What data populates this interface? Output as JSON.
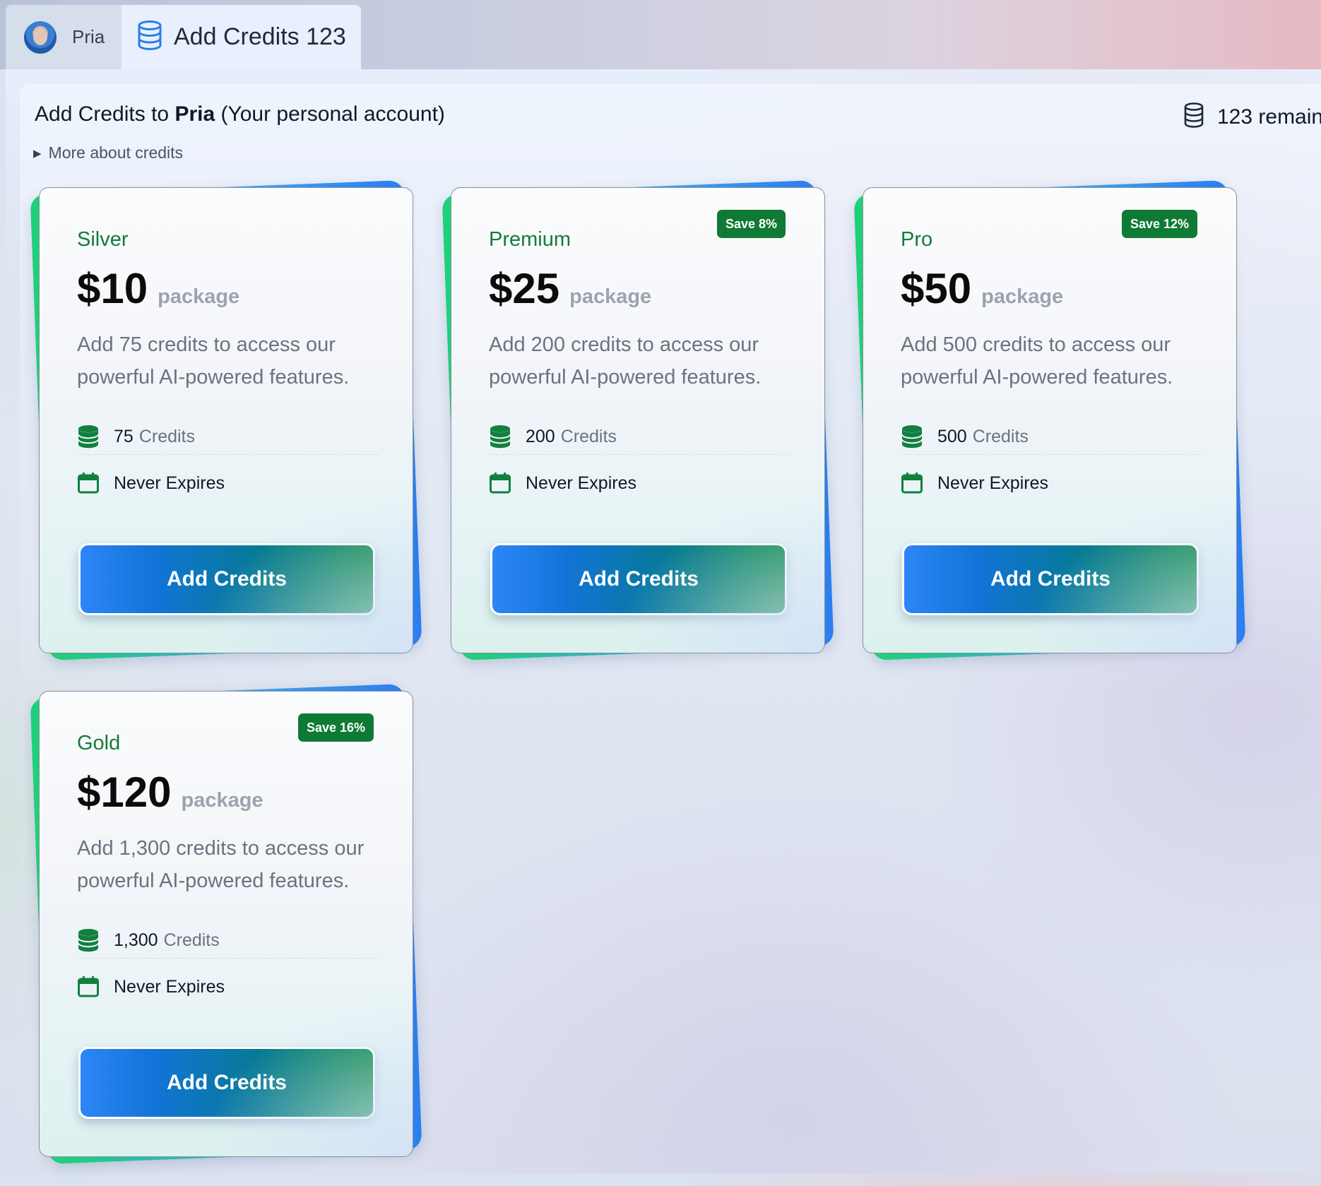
{
  "tabs": {
    "pria": {
      "label": "Pria"
    },
    "add_credits": {
      "label": "Add Credits 123"
    }
  },
  "header": {
    "prefix": "Add Credits to ",
    "account_name": "Pria",
    "suffix": " (Your personal account)",
    "remaining": "123 remain",
    "more_about": "More about credits"
  },
  "packages": [
    {
      "tier": "Silver",
      "badge": "",
      "price": "$10",
      "price_unit": "package",
      "description": "Add 75 credits to access our powerful AI-powered features.",
      "credits_value": "75",
      "credits_unit": "Credits",
      "expires": "Never Expires",
      "button": "Add Credits"
    },
    {
      "tier": "Premium",
      "badge": "Save 8%",
      "price": "$25",
      "price_unit": "package",
      "description": "Add 200 credits to access our powerful AI-powered features.",
      "credits_value": "200",
      "credits_unit": "Credits",
      "expires": "Never Expires",
      "button": "Add Credits"
    },
    {
      "tier": "Pro",
      "badge": "Save 12%",
      "price": "$50",
      "price_unit": "package",
      "description": "Add 500 credits to access our powerful AI-powered features.",
      "credits_value": "500",
      "credits_unit": "Credits",
      "expires": "Never Expires",
      "button": "Add Credits"
    },
    {
      "tier": "Gold",
      "badge": "Save 16%",
      "price": "$120",
      "price_unit": "package",
      "description": "Add 1,300 credits to access our powerful AI-powered features.",
      "credits_value": "1,300",
      "credits_unit": "Credits",
      "expires": "Never Expires",
      "button": "Add Credits"
    }
  ],
  "icons": {
    "tab_avatar": "avatar",
    "tab_credits": "database-icon",
    "remaining": "database-icon",
    "more": "triangle-right-icon",
    "credits": "coins-stack-icon",
    "expires": "calendar-icon"
  },
  "colors": {
    "tier_green": "#157a3a",
    "badge_green": "#0f7a35",
    "button_blue": "#2d86f7",
    "button_green": "#0a8a44",
    "tab_icon_blue": "#2b7de9"
  }
}
